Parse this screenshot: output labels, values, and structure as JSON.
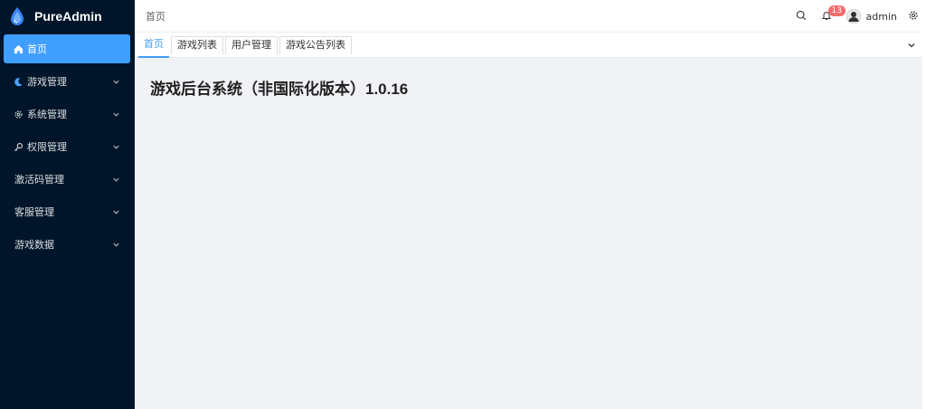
{
  "app": {
    "name": "PureAdmin"
  },
  "sidebar": {
    "items": [
      {
        "label": "首页",
        "icon": "home-icon",
        "active": true
      },
      {
        "label": "游戏管理",
        "icon": "moon-icon"
      },
      {
        "label": "系统管理",
        "icon": "gear-icon"
      },
      {
        "label": "权限管理",
        "icon": "key-icon"
      },
      {
        "label": "激活码管理",
        "icon": ""
      },
      {
        "label": "客服管理",
        "icon": ""
      },
      {
        "label": "游戏数据",
        "icon": ""
      }
    ]
  },
  "header": {
    "breadcrumb": "首页",
    "notification_count": "13",
    "username": "admin"
  },
  "tabs": [
    {
      "label": "首页",
      "active": true
    },
    {
      "label": "游戏列表"
    },
    {
      "label": "用户管理"
    },
    {
      "label": "游戏公告列表"
    }
  ],
  "main": {
    "title": "游戏后台系统（非国际化版本）1.0.16"
  },
  "colors": {
    "sidebar_bg": "#001529",
    "accent": "#409eff",
    "badge": "#f56c6c"
  }
}
